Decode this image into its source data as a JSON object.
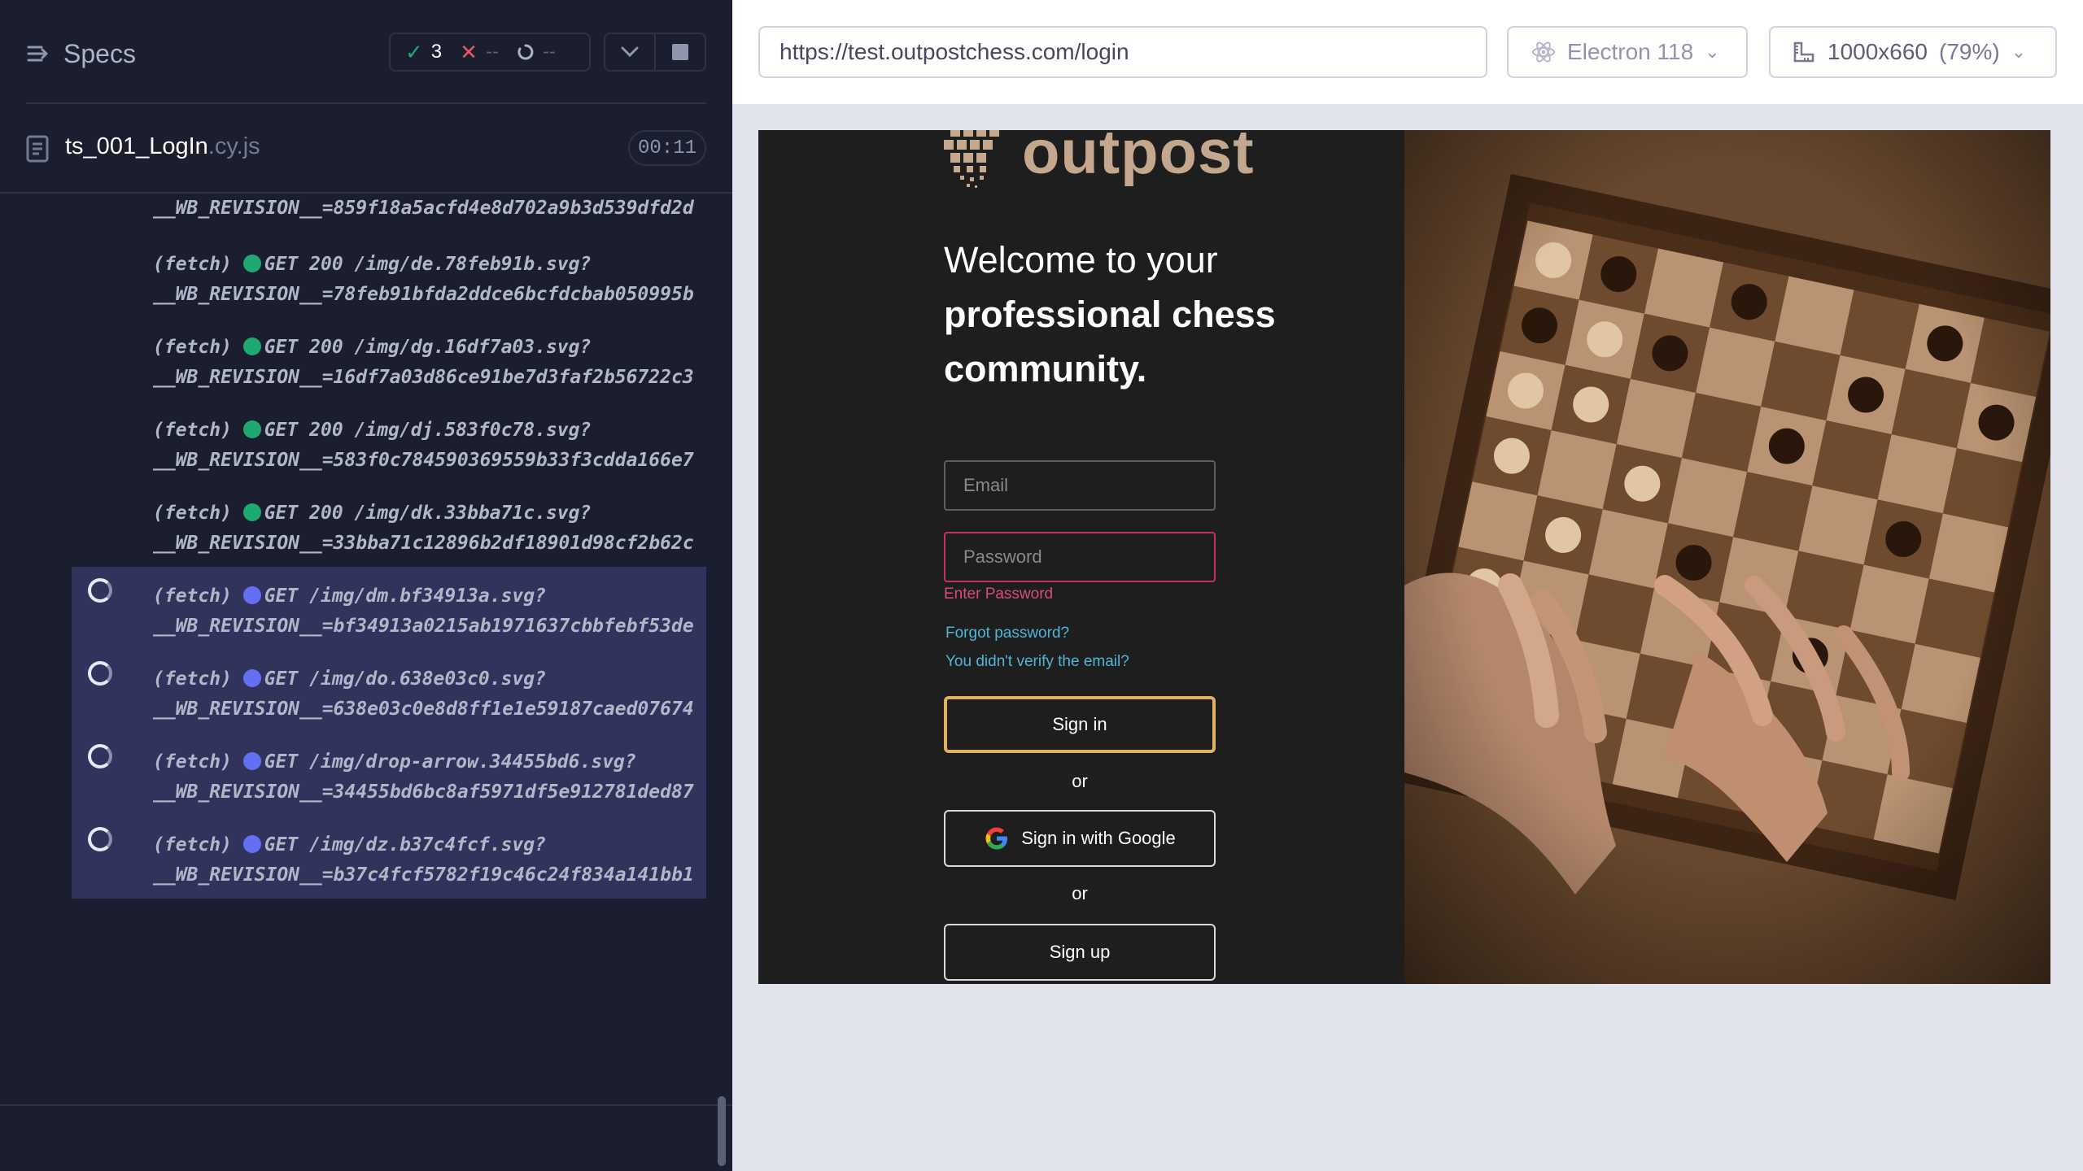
{
  "reporter": {
    "specs_label": "Specs",
    "stats": {
      "passed": "3",
      "failed": "--",
      "pending": "--"
    },
    "spec": {
      "name": "ts_001_LogIn",
      "ext": ".cy.js",
      "duration": "00:11"
    }
  },
  "log": [
    {
      "text": "__WB_REVISION__=859f18a5acfd4e8d702a9b3d539dfd2d",
      "status": "partial"
    },
    {
      "prefix": "(fetch) ",
      "method": "GET 200 /img/de.78feb91b.svg?",
      "rest": "__WB_REVISION__=78feb91bfda2ddce6bcfdcbab050995b",
      "status": "done"
    },
    {
      "prefix": "(fetch) ",
      "method": "GET 200 /img/dg.16df7a03.svg?",
      "rest": "__WB_REVISION__=16df7a03d86ce91be7d3faf2b56722c3",
      "status": "done"
    },
    {
      "prefix": "(fetch) ",
      "method": "GET 200 /img/dj.583f0c78.svg?",
      "rest": "__WB_REVISION__=583f0c784590369559b33f3cdda166e7",
      "status": "done"
    },
    {
      "prefix": "(fetch) ",
      "method": "GET 200 /img/dk.33bba71c.svg?",
      "rest": "__WB_REVISION__=33bba71c12896b2df18901d98cf2b62c",
      "status": "done"
    },
    {
      "prefix": "(fetch) ",
      "method": "GET /img/dm.bf34913a.svg?",
      "rest": "__WB_REVISION__=bf34913a0215ab1971637cbbfebf53de",
      "status": "pending"
    },
    {
      "prefix": "(fetch) ",
      "method": "GET /img/do.638e03c0.svg?",
      "rest": "__WB_REVISION__=638e03c0e8d8ff1e1e59187caed07674",
      "status": "pending"
    },
    {
      "prefix": "(fetch) ",
      "method": "GET /img/drop-arrow.34455bd6.svg?",
      "rest": "__WB_REVISION__=34455bd6bc8af5971df5e912781ded87",
      "status": "pending"
    },
    {
      "prefix": "(fetch) ",
      "method": "GET /img/dz.b37c4fcf.svg?",
      "rest": "__WB_REVISION__=b37c4fcf5782f19c46c24f834a141bb1",
      "status": "pending"
    }
  ],
  "aut": {
    "url": "https://test.outpostchess.com/login",
    "browser": "Electron 118",
    "viewport": "1000x660",
    "scale": "(79%)"
  },
  "app": {
    "logo_text": "outpost",
    "welcome_line1": "Welcome to your",
    "welcome_line2": "professional chess",
    "welcome_line3": "community.",
    "email_placeholder": "Email",
    "password_placeholder": "Password",
    "password_error": "Enter Password",
    "forgot_link": "Forgot password?",
    "verify_link": "You didn't verify the email?",
    "signin_label": "Sign in",
    "or_label": "or",
    "google_label": "Sign in with Google",
    "signup_label": "Sign up"
  },
  "colors": {
    "reporter_bg": "#1b1e2e",
    "dot_done": "#1fa971",
    "dot_pending": "#6470f3",
    "pending_row_bg": "#30345c",
    "app_bg": "#1e1e1e",
    "signin_border": "#e2b260",
    "error": "#d84c7c",
    "link": "#4db6d8"
  },
  "icons": [
    "specs-toggle-icon",
    "check-icon",
    "x-icon",
    "spinner-icon",
    "chevron-down-icon",
    "stop-icon",
    "file-icon",
    "electron-icon",
    "ruler-icon",
    "google-icon",
    "outpost-logo-icon"
  ]
}
